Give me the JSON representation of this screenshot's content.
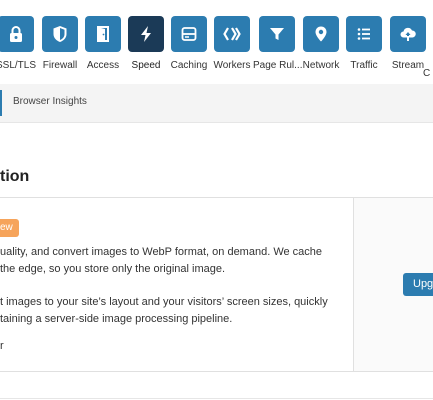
{
  "nav": {
    "items": [
      {
        "label": "SSL/TLS",
        "icon": "lock-icon"
      },
      {
        "label": "Firewall",
        "icon": "shield-icon"
      },
      {
        "label": "Access",
        "icon": "door-icon"
      },
      {
        "label": "Speed",
        "icon": "lightning-icon",
        "active": true
      },
      {
        "label": "Caching",
        "icon": "server-icon"
      },
      {
        "label": "Workers",
        "icon": "workers-icon"
      },
      {
        "label": "Page Rul...",
        "icon": "filter-icon"
      },
      {
        "label": "Network",
        "icon": "location-pin-icon"
      },
      {
        "label": "Traffic",
        "icon": "list-icon"
      },
      {
        "label": "Stream",
        "icon": "cloud-upload-icon"
      },
      {
        "label": "C",
        "icon": "partial-icon"
      }
    ]
  },
  "subnav": {
    "item": "Browser Insights"
  },
  "section": {
    "title": "tion",
    "badge": "ew",
    "p1_line1": "uality, and convert images to WebP format, on demand. We cache",
    "p1_line2": " the edge, so you store only the original image.",
    "p2_line1": "t images to your site’s layout and your visitors’ screen sizes, quickly",
    "p2_line2": "taining a server-side image processing pipeline.",
    "p3": "r",
    "upgrade": "Upg"
  },
  "colors": {
    "nav_button": "#2c7cb0",
    "nav_active": "#1b3a57",
    "badge": "#f6a45b"
  }
}
